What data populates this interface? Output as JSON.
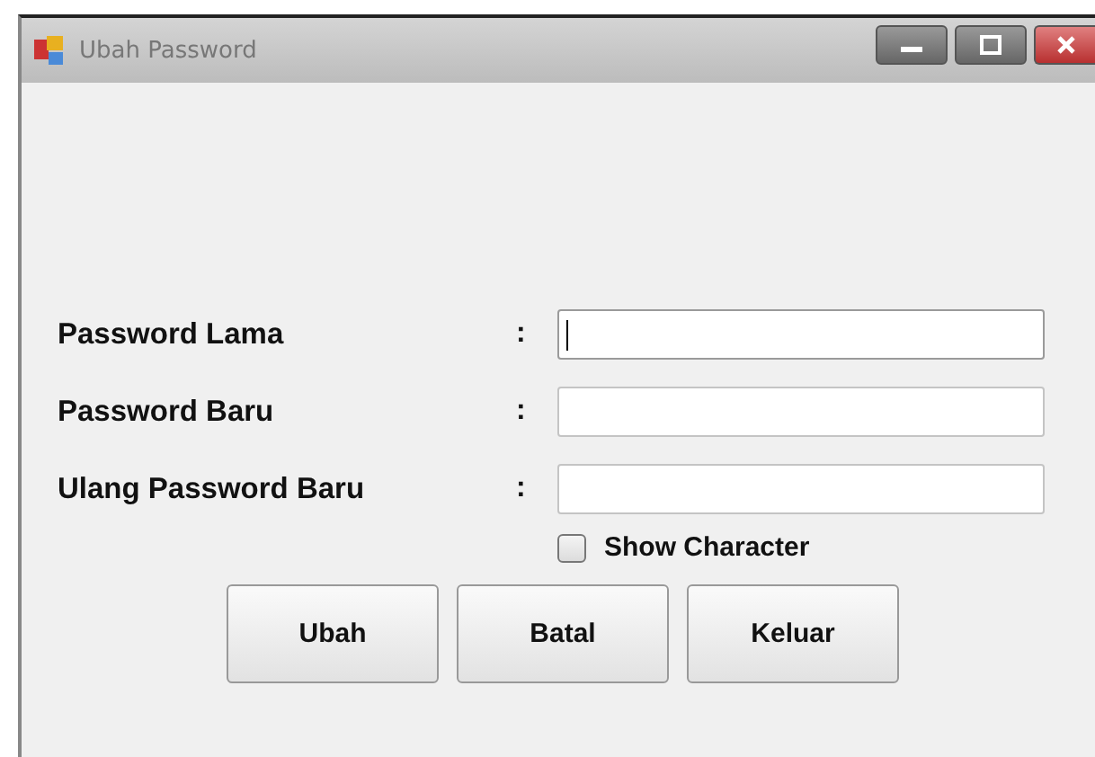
{
  "window": {
    "title": "Ubah Password"
  },
  "fields": [
    {
      "label": "Password Lama",
      "separator": ":",
      "focused": true
    },
    {
      "label": "Password Baru",
      "separator": ":",
      "focused": false
    },
    {
      "label": "Ulang Password Baru",
      "separator": ":",
      "focused": false
    }
  ],
  "show_character": {
    "label": "Show Character",
    "checked": false
  },
  "buttons": [
    "Ubah",
    "Batal",
    "Keluar"
  ]
}
